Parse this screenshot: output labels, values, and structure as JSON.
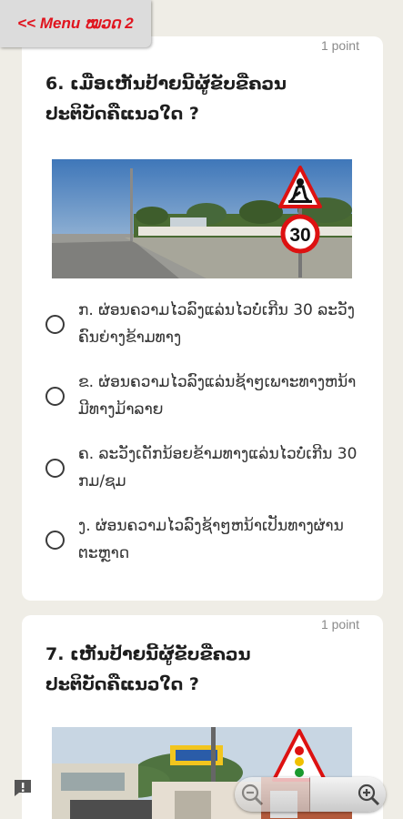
{
  "menu": {
    "label": "<< Menu ໝວດ 2"
  },
  "questions": [
    {
      "title": "6. ເມື່ອເຫັນປ້າຍນີ້ຜູ້ຂັບຂີ່ຄວນປະຕິບັດຄືແນວໃດ ?",
      "points": "1 point",
      "image": {
        "description_icon": "photo-road-sign",
        "sign_speed": "30"
      },
      "options": [
        {
          "label": "ກ. ຜ່ອນຄວາມໄວລົງແລ່ນໄວບໍ່ເກີນ 30 ລະວັງຄົນຍ່າງຂ້າມທາງ"
        },
        {
          "label": "ຂ. ຜ່ອນຄວາມໄວລົງແລ່ນຊ້າໆເພາະທາງຫນ້າມີທາງມ້າລາຍ"
        },
        {
          "label": "ຄ. ລະວັງເດັກນ້ອຍຂ້າມທາງແລ່ນໄວບໍ່ເກີນ 30 ກມ/ຊມ"
        },
        {
          "label": "ງ. ຜ່ອນຄວາມໄວລົງຊ້າໆຫນ້າເປັນທາງຜ່ານຕະຫຼາດ"
        }
      ]
    },
    {
      "title": "7. ເຫັນປ້າຍນີ້ຜູ້ຂັບຂີ່ຄວນປະຕິບັດຄືແນວໃດ ?",
      "points": "1 point",
      "image": {
        "description_icon": "photo-traffic-light-sign"
      }
    }
  ],
  "colors": {
    "menu_text": "#e0141e",
    "background": "#efede6",
    "card": "#ffffff"
  },
  "icons": {
    "report": "report-icon",
    "zoom_in": "zoom-in-icon",
    "zoom_out": "zoom-out-icon"
  }
}
